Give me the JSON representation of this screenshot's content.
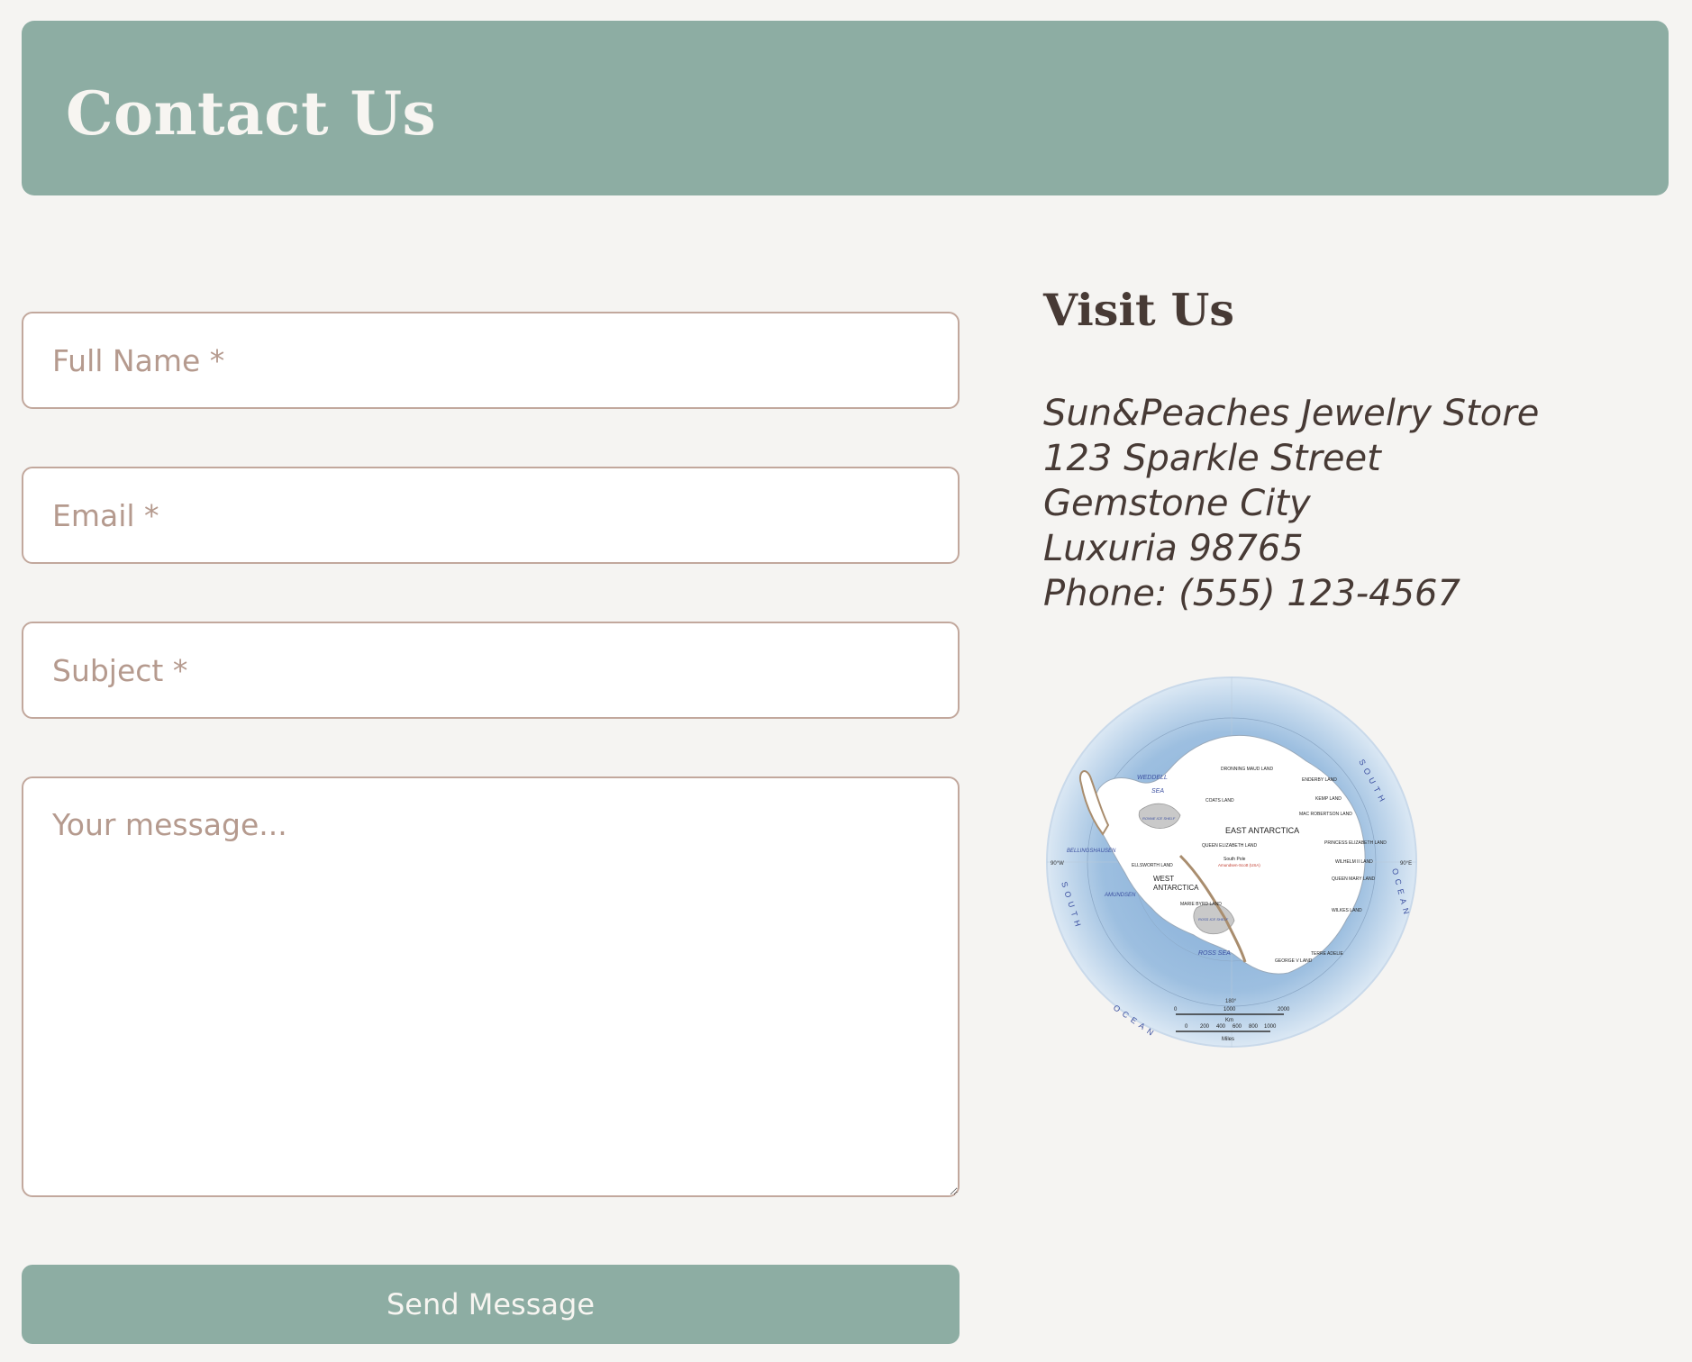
{
  "header": {
    "title": "Contact Us"
  },
  "form": {
    "name_placeholder": "Full Name *",
    "email_placeholder": "Email *",
    "subject_placeholder": "Subject *",
    "message_placeholder": "Your message...",
    "submit_label": "Send Message"
  },
  "visit": {
    "title": "Visit Us",
    "address_lines": [
      "Sun&Peaches Jewelry Store",
      "123 Sparkle Street",
      "Gemstone City",
      "Luxuria 98765",
      "Phone: (555) 123-4567"
    ]
  },
  "map": {
    "labels": {
      "east": "EAST ANTARCTICA",
      "west": "WEST",
      "west2": "ANTARCTICA",
      "weddell": "WEDDELL",
      "sea": "SEA",
      "ross": "ROSS SEA",
      "bellingshausen": "BELLINGSHAUSEN",
      "amundsen": "AMUNDSEN",
      "south_ocean": "SOUTH RN OCEAN",
      "queen_maud": "DRONNING MAUD LAND",
      "enderby": "ENDERBY LAND",
      "kemp": "KEMP LAND",
      "mac_robertson": "MAC ROBERTSON LAND",
      "princess_elizabeth": "PRINCESS ELIZABETH LAND",
      "wilhelm": "WILHELM II LAND",
      "queen_mary": "QUEEN MARY LAND",
      "wilkes": "WILKES LAND",
      "terre_adelie": "TERRE ADELIE",
      "george_v": "GEORGE V LAND",
      "coats": "COATS LAND",
      "marie_byrd": "MARIE BYRD LAND",
      "ellsworth": "ELLSWORTH LAND",
      "queen_elizabeth": "QUEEN ELIZABETH LAND",
      "south_pole": "South Pole",
      "amundsen_scott": "Amundsen-Scott (USA)",
      "ronne": "RONNE ICE SHELF",
      "ross_ice": "ROSS ICE SHELF",
      "lon_west": "90°W",
      "lon_east": "90°E",
      "lon_180": "180°",
      "km": "Km",
      "miles": "Miles",
      "km_ticks": [
        "0",
        "1000",
        "2000"
      ],
      "mile_ticks": [
        "0",
        "200",
        "400",
        "600",
        "800",
        "1000"
      ]
    },
    "colors": {
      "ocean": "#9dbfe0",
      "ice": "#ffffff",
      "land": "#b89a7a",
      "shelf": "#c9c9c9"
    }
  },
  "colors": {
    "accent": "#8dada3",
    "background": "#f5f4f2",
    "field_border": "#c2a89d",
    "placeholder": "#b59a8e",
    "text_dark": "#473a35"
  }
}
